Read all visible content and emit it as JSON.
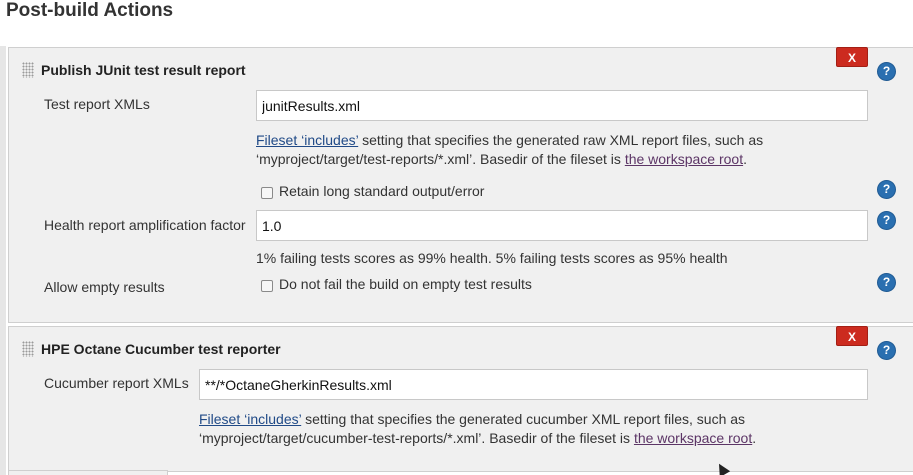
{
  "section": {
    "title": "Post-build Actions"
  },
  "junit": {
    "title": "Publish JUnit test result report",
    "delete_label": "X",
    "help_label": "?",
    "test_report_label": "Test report XMLs",
    "test_report_value": "junitResults.xml",
    "desc_link": "Fileset ‘includes’",
    "desc_mid1": " setting that specifies the generated raw XML report files, such as",
    "desc_mid2": "‘myproject/target/test-reports/*.xml’. Basedir of the fileset is ",
    "desc_link2": "the workspace root",
    "desc_end": ".",
    "retain_label": "Retain long standard output/error",
    "retain_checked": false,
    "health_label": "Health report amplification factor",
    "health_value": "1.0",
    "health_desc": "1% failing tests scores as 99% health. 5% failing tests scores as 95% health",
    "allow_empty_label": "Allow empty results",
    "allow_empty_checkbox_label": "Do not fail the build on empty test results",
    "allow_empty_checked": false
  },
  "octane": {
    "title": "HPE Octane Cucumber test reporter",
    "delete_label": "X",
    "help_label": "?",
    "report_label": "Cucumber report XMLs",
    "report_value": "**/*OctaneGherkinResults.xml",
    "desc_link": "Fileset ‘includes’",
    "desc_mid1": " setting that specifies the generated cucumber XML report files, such as",
    "desc_mid2": "‘myproject/target/cucumber-test-reports/*.xml’. Basedir of the fileset is ",
    "desc_link2": "the workspace root",
    "desc_end": "."
  }
}
